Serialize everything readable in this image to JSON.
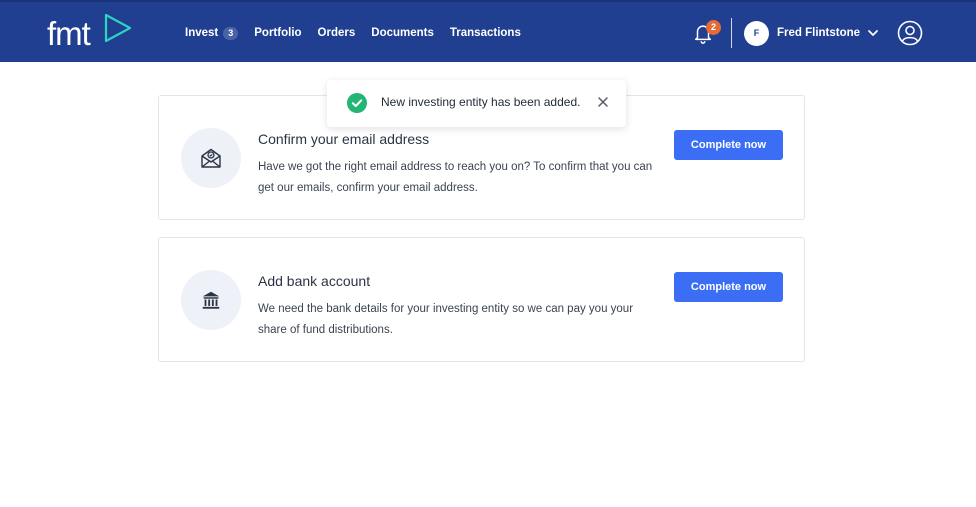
{
  "brand": {
    "logo_text": "fmt",
    "accent": "#2dd4bf"
  },
  "nav": {
    "items": [
      {
        "label": "Invest",
        "badge": "3"
      },
      {
        "label": "Portfolio"
      },
      {
        "label": "Orders"
      },
      {
        "label": "Documents"
      },
      {
        "label": "Transactions"
      }
    ]
  },
  "header": {
    "notifications_count": "2",
    "user_initial": "F",
    "user_name": "Fred Flintstone",
    "bg_color": "#213f91"
  },
  "toast": {
    "message": "New investing entity has been added.",
    "icon": "check-circle-icon",
    "color": "#22b573"
  },
  "cards": [
    {
      "icon": "email-verify-icon",
      "title": "Confirm your email address",
      "description": "Have we got the right email address to reach you on? To confirm that you can get our emails, confirm your email address.",
      "button_label": "Complete now"
    },
    {
      "icon": "bank-icon",
      "title": "Add bank account",
      "description": "We need the bank details for your investing entity so we can pay you your share of fund distributions.",
      "button_label": "Complete now"
    }
  ],
  "cta_color": "#3b6ef5"
}
